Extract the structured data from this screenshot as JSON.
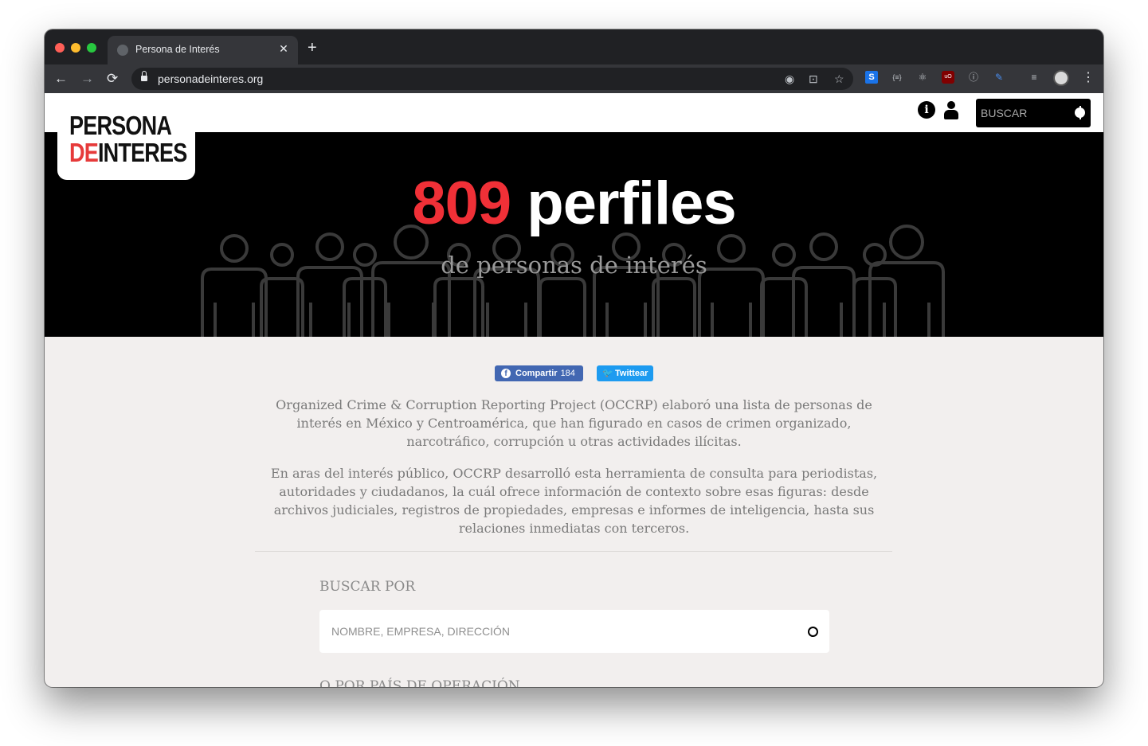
{
  "browser": {
    "tab_title": "Persona de Interés",
    "tab_close": "✕",
    "new_tab": "+",
    "url": "personadeinteres.org",
    "back": "←",
    "forward": "→",
    "reload": "⟳",
    "kebab": "⋮"
  },
  "site": {
    "logo": {
      "line1": "PERSONA",
      "line2_de": "DE",
      "line2_rest": "INTERES"
    },
    "info_label": "i",
    "search_placeholder": "BUSCAR"
  },
  "hero": {
    "count": "809",
    "word": "perfiles",
    "subtitle": "de personas de interés"
  },
  "share": {
    "facebook_label": "Compartir",
    "facebook_count": "184",
    "twitter_label": "Twittear"
  },
  "intro": {
    "p1": "Organized Crime & Corruption Reporting Project (OCCRP) elaboró una lista de personas de interés en México y Centroamérica, que han figurado en casos de crimen organizado, narcotráfico, corrupción u otras actividades ilícitas.",
    "p2": "En aras del interés público, OCCRP desarrolló esta herramienta de consulta para periodistas, autoridades y ciudadanos, la cuál ofrece información de contexto sobre esas figuras: desde archivos judiciales, registros de propiedades, empresas e informes de inteligencia, hasta sus relaciones inmediatas con terceros."
  },
  "search": {
    "label": "BUSCAR POR",
    "placeholder": "NOMBRE, EMPRESA, DIRECCIÓN",
    "label2": "O POR PAÍS DE OPERACIÓN"
  },
  "colors": {
    "accent_red": "#f03037",
    "facebook": "#4267b2",
    "twitter": "#1d9bf0",
    "page_bg": "#f2efee"
  }
}
